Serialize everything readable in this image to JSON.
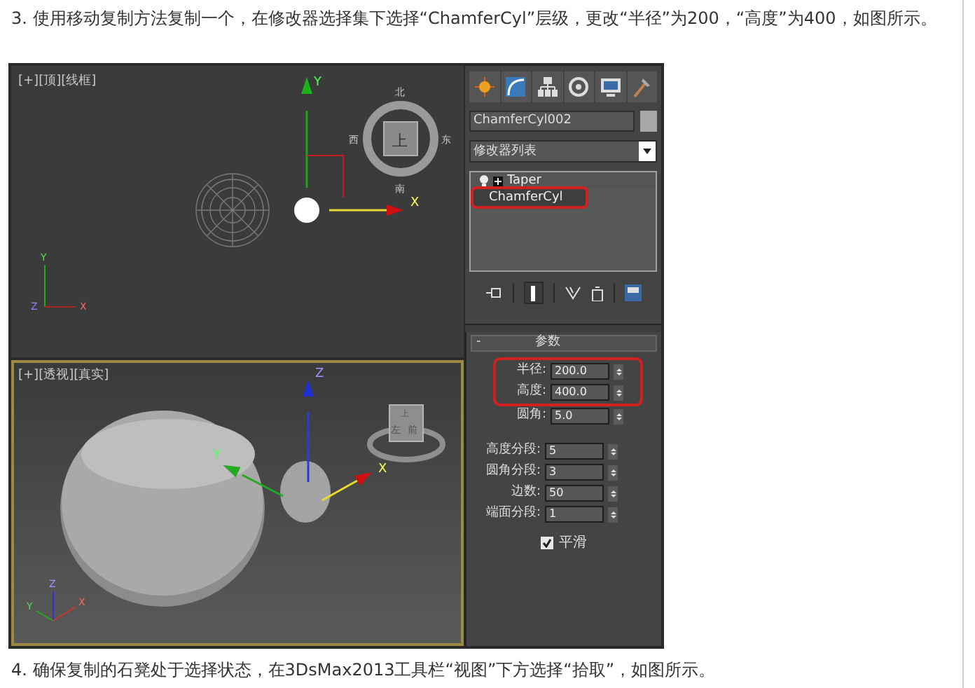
{
  "step_text_top": "3. 使用移动复制方法复制一个，在修改器选择集下选择“ChamferCyl”层级，更改“半径”为200，“高度”为400，如图所示。",
  "viewports": [
    {
      "kind": "top",
      "label": "[+][顶][线框]",
      "active": false,
      "gizmo_labels": [
        "Y",
        "X"
      ],
      "corner_labels": [
        "Y",
        "Z",
        "X"
      ],
      "viewcube_labels": [
        "北",
        "西",
        "上",
        "东",
        "南"
      ]
    },
    {
      "kind": "perspective",
      "label": "[+][透视][真实]",
      "active": true,
      "gizmo_labels": [
        "Z",
        "Y",
        "X"
      ],
      "corner_labels": [
        "Z",
        "Y",
        "X"
      ],
      "viewcube_labels": [
        "上",
        "左",
        "前"
      ]
    }
  ],
  "command_panel": {
    "object_name": "ChamferCyl002",
    "modifier_list": "修改器列表",
    "stack": [
      {
        "label": "Taper",
        "kind": "modifier",
        "selected": false,
        "annotated": false
      },
      {
        "label": "ChamferCyl",
        "kind": "object",
        "selected": true,
        "annotated": true
      }
    ],
    "rollout_title": "参数",
    "rollout_toggle": "-",
    "params": [
      {
        "label": "半径:",
        "value": "200.0",
        "annotated": true
      },
      {
        "label": "高度:",
        "value": "400.0",
        "annotated": true
      },
      {
        "label": "圆角:",
        "value": "5.0",
        "annotated": false
      },
      {
        "label": "高度分段:",
        "value": "5",
        "annotated": false
      },
      {
        "label": "圆角分段:",
        "value": "3",
        "annotated": false
      },
      {
        "label": "边数:",
        "value": "50",
        "annotated": false
      },
      {
        "label": "端面分段:",
        "value": "1",
        "annotated": false
      }
    ],
    "smooth": {
      "label": "平滑",
      "checked": true
    }
  },
  "step_text_bottom": "4. 确保复制的石凳处于选择状态，在3DsMax2013工具栏“视图”下方选择“拾取”，如图所示。"
}
